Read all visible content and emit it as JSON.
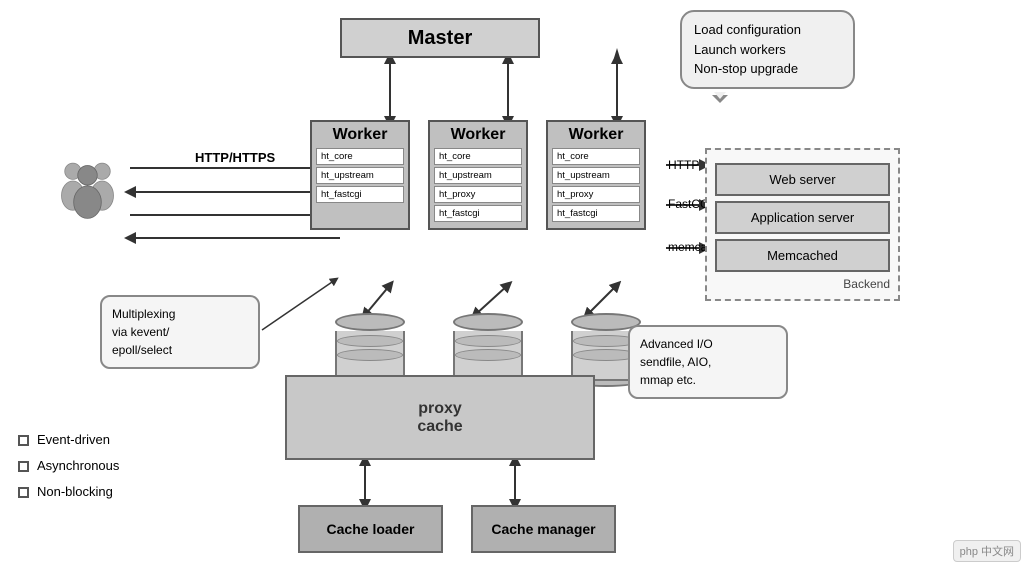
{
  "master": {
    "label": "Master"
  },
  "callout_topleft": {
    "lines": [
      "Load configuration",
      "Launch workers",
      "Non-stop upgrade"
    ]
  },
  "workers": [
    {
      "title": "Worker",
      "modules": [
        "ht_core",
        "ht_upstream",
        "ht_fastcgi"
      ]
    },
    {
      "title": "Worker",
      "modules": [
        "ht_core",
        "ht_upstream",
        "ht_proxy",
        "ht_fastcgi"
      ]
    },
    {
      "title": "Worker",
      "modules": [
        "ht_core",
        "ht_upstream",
        "ht_proxy",
        "ht_fastcgi"
      ]
    }
  ],
  "http_label": "HTTP/HTTPS",
  "conn_labels": {
    "http": "HTTP",
    "fastcgi": "FastCGI",
    "memcache": "memcache"
  },
  "backend": {
    "label": "Backend",
    "items": [
      "Web server",
      "Application server",
      "Memcached"
    ]
  },
  "proxy_cache": {
    "line1": "proxy",
    "line2": "cache"
  },
  "cache_boxes": {
    "loader": "Cache loader",
    "manager": "Cache manager"
  },
  "callout_multiplex": {
    "lines": [
      "Multiplexing",
      "via kevent/",
      "epoll/select"
    ]
  },
  "callout_adv_io": {
    "lines": [
      "Advanced I/O",
      "sendfile, AIO,",
      "mmap etc."
    ]
  },
  "legend": {
    "items": [
      "Event-driven",
      "Asynchronous",
      "Non-blocking"
    ]
  },
  "php_logo": "php 中文网"
}
